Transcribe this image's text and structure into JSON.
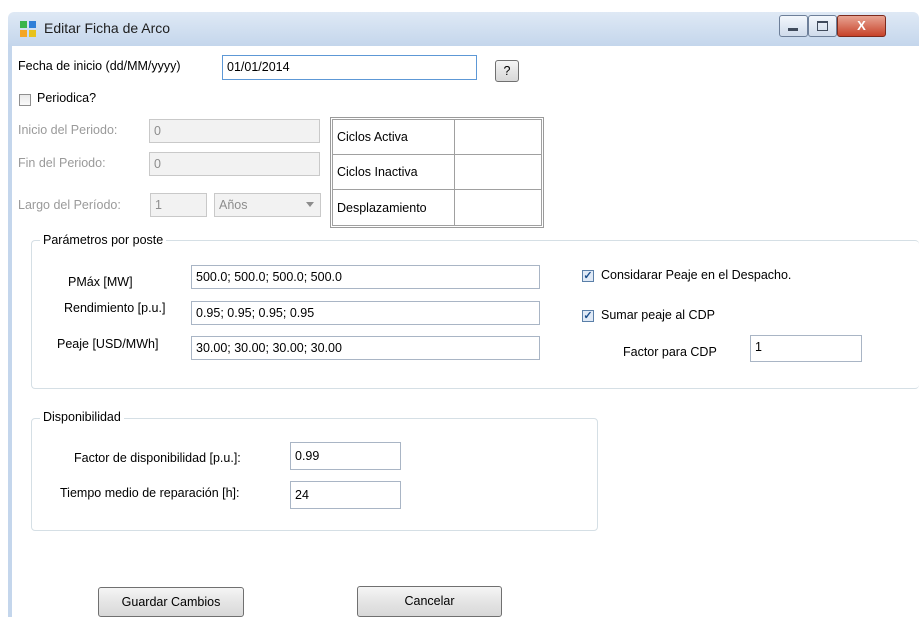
{
  "window": {
    "title": "Editar Ficha de Arco",
    "close_glyph": "X"
  },
  "fecha": {
    "label": "Fecha de inicio (dd/MM/yyyy)",
    "value": "01/01/2014",
    "help_label": "?"
  },
  "periodica": {
    "label": "Periodica?",
    "checked": false
  },
  "periodo": {
    "inicio_label": "Inicio del Periodo:",
    "inicio_value": "0",
    "fin_label": "Fin del Periodo:",
    "fin_value": "0",
    "largo_label": "Largo del Período:",
    "largo_value": "1",
    "unidad_value": "Años"
  },
  "ciclos": [
    {
      "label": "Ciclos Activa",
      "value": ""
    },
    {
      "label": "Ciclos Inactiva",
      "value": ""
    },
    {
      "label": "Desplazamiento",
      "value": ""
    }
  ],
  "parametros": {
    "group_title": "Parámetros por poste",
    "pmax_label": "PMáx [MW]",
    "pmax_value": "500.0; 500.0; 500.0; 500.0",
    "rend_label": "Rendimiento [p.u.]",
    "rend_value": "0.95; 0.95; 0.95; 0.95",
    "peaje_label": "Peaje [USD/MWh]",
    "peaje_value": "30.00; 30.00; 30.00; 30.00",
    "considerar_label": "Considarar Peaje en el Despacho.",
    "considerar_checked": true,
    "sumar_label": "Sumar peaje al CDP",
    "sumar_checked": true,
    "factor_cdp_label": "Factor para CDP",
    "factor_cdp_value": "1"
  },
  "disponibilidad": {
    "group_title": "Disponibilidad",
    "factor_label": "Factor de disponibilidad [p.u.]:",
    "factor_value": "0.99",
    "tiempo_label": "Tiempo medio de reparación [h]:",
    "tiempo_value": "24"
  },
  "actions": {
    "save_label": "Guardar Cambios",
    "cancel_label": "Cancelar"
  },
  "check_glyph": "✓"
}
